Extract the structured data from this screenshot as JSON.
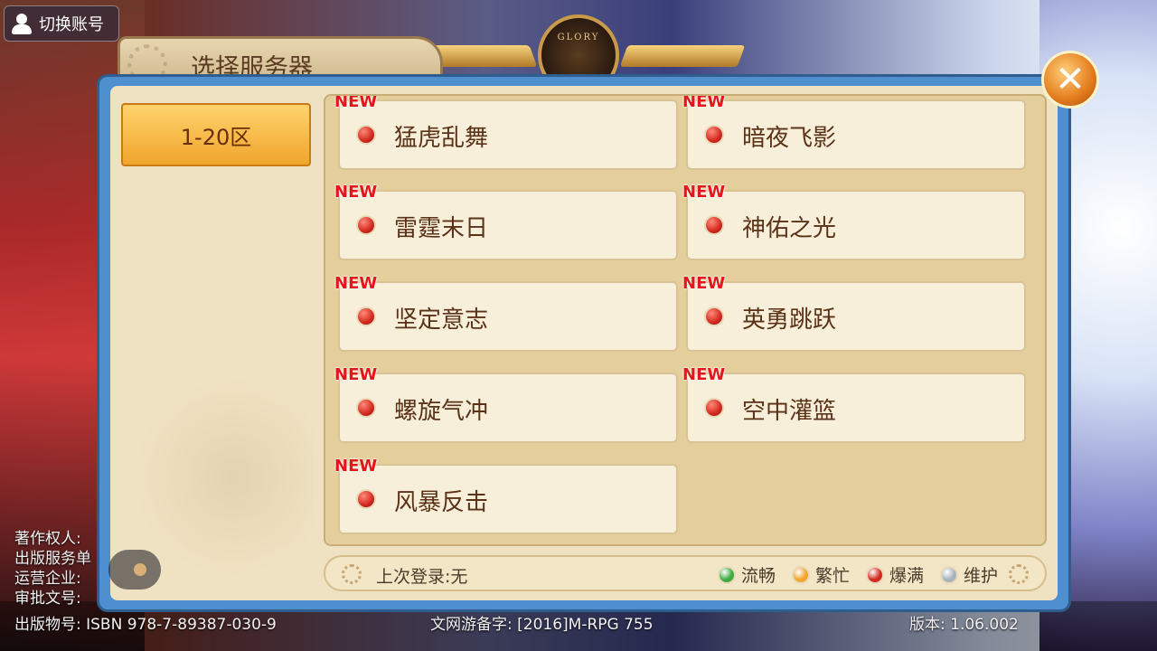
{
  "account_button": {
    "label": "切换账号"
  },
  "emblem": {
    "text": "GLORY"
  },
  "panel": {
    "title": "选择服务器"
  },
  "zones": [
    {
      "label": "1-20区",
      "selected": true
    }
  ],
  "servers": [
    {
      "badge": "NEW",
      "name": "猛虎乱舞",
      "status_color": "#d3291f"
    },
    {
      "badge": "NEW",
      "name": "暗夜飞影",
      "status_color": "#d3291f"
    },
    {
      "badge": "NEW",
      "name": "雷霆末日",
      "status_color": "#d3291f"
    },
    {
      "badge": "NEW",
      "name": "神佑之光",
      "status_color": "#d3291f"
    },
    {
      "badge": "NEW",
      "name": "坚定意志",
      "status_color": "#d3291f"
    },
    {
      "badge": "NEW",
      "name": "英勇跳跃",
      "status_color": "#d3291f"
    },
    {
      "badge": "NEW",
      "name": "螺旋气冲",
      "status_color": "#d3291f"
    },
    {
      "badge": "NEW",
      "name": "空中灌篮",
      "status_color": "#d3291f"
    },
    {
      "badge": "NEW",
      "name": "风暴反击",
      "status_color": "#d3291f"
    }
  ],
  "footer": {
    "last_login": "上次登录:无",
    "legend": [
      {
        "label": "流畅",
        "color": "#3faa3f"
      },
      {
        "label": "繁忙",
        "color": "#f0a52c"
      },
      {
        "label": "爆满",
        "color": "#d3291f"
      },
      {
        "label": "维护",
        "color": "#a8b2bd"
      }
    ]
  },
  "bottom_info": {
    "lines": [
      "著作权人:",
      "出版服务单",
      "运营企业:",
      "审批文号:"
    ],
    "isbn_left": "出版物号: ISBN 978-7-89387-030-9",
    "isbn_mid": "文网游备字: [2016]M-RPG 755",
    "version": "版本: 1.06.002"
  }
}
